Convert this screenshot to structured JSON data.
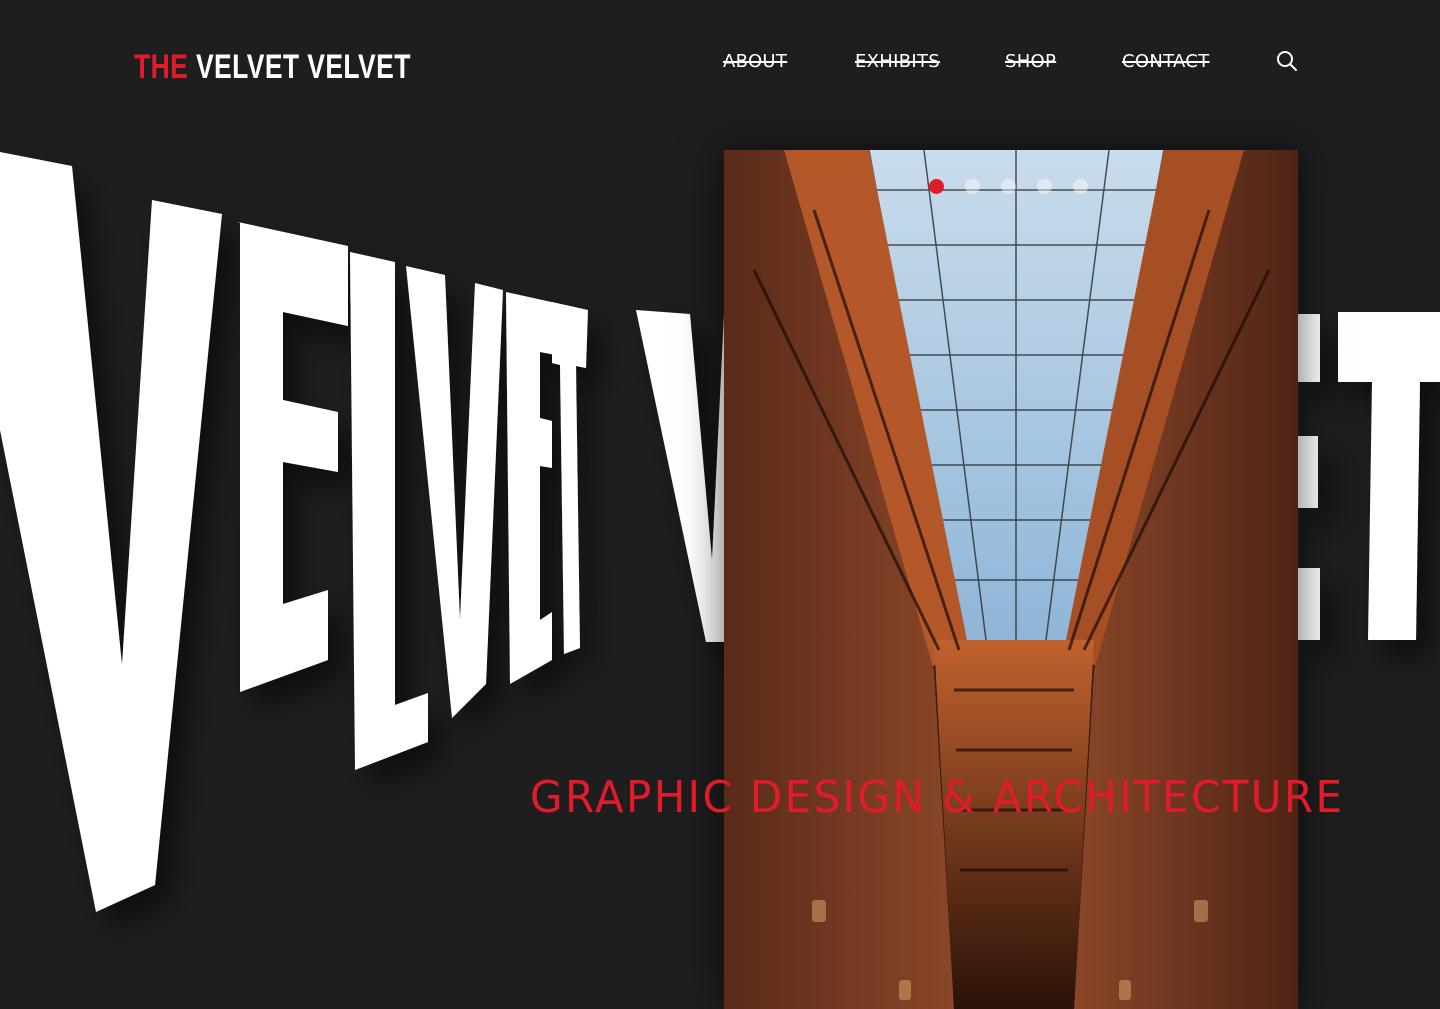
{
  "brand": {
    "the": "THE",
    "rest": "VELVET VELVET"
  },
  "nav": {
    "items": [
      {
        "label": "ABOUT"
      },
      {
        "label": "EXHIBITS"
      },
      {
        "label": "SHOP"
      },
      {
        "label": "CONTACT"
      }
    ],
    "search_icon": "search-icon"
  },
  "hero": {
    "big_word": "VELVET",
    "tagline": "GRAPHIC DESIGN & ARCHITECTURE",
    "image_alt": "atrium with glass skylight and iron balconies",
    "slides": {
      "count": 5,
      "active": 1
    }
  },
  "colors": {
    "background": "#1f1e1f",
    "accent": "#e21b2a",
    "text": "#ffffff"
  }
}
